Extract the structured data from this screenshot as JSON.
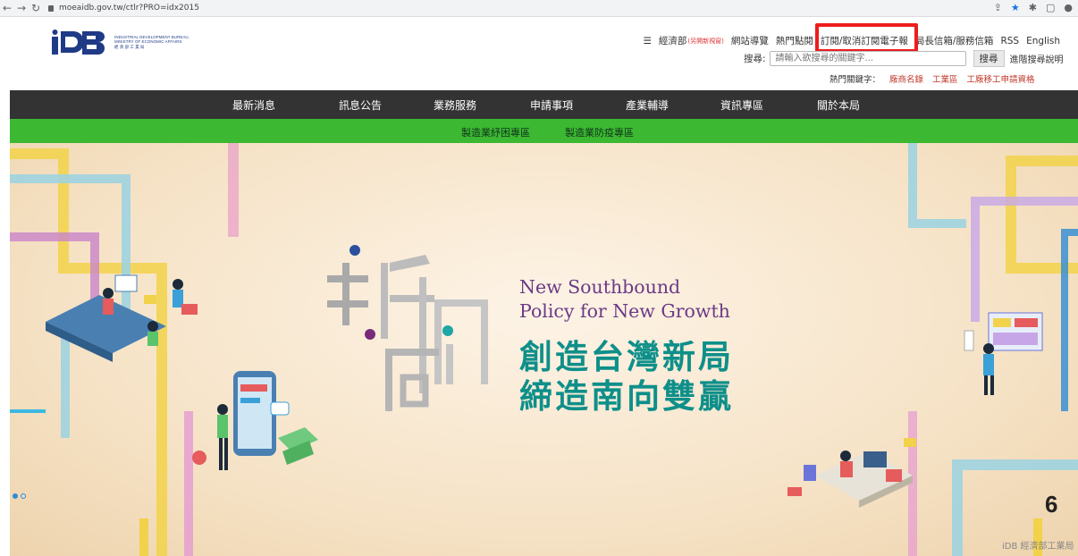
{
  "browser": {
    "url": "moeaidb.gov.tw/ctlr?PRO=idx2015"
  },
  "logo": {
    "mark": "iDB",
    "line1": "INDUSTRIAL DEVELOPMENT BUREAU,",
    "line2": "MINISTRY OF ECONOMIC AFFAIRS",
    "line3": "經 濟 部 工 業 局"
  },
  "top_links": {
    "moea": "經濟部",
    "moea_note": "(另開新視窗)",
    "sitemap": "網站導覽",
    "hot": "熱門點閱",
    "subscribe": "訂閱/取消訂閱電子報",
    "mailbox": "局長信箱/服務信箱",
    "rss": "RSS",
    "english": "English"
  },
  "search": {
    "label": "搜尋:",
    "placeholder": "請輸入欲搜尋的關鍵字...",
    "button": "搜尋",
    "advanced": "進階搜尋說明"
  },
  "hot_keywords": {
    "label": "熱門關鍵字：",
    "items": [
      "廠商名錄",
      "工業區",
      "工廠移工申請資格"
    ]
  },
  "main_nav": [
    "最新消息",
    "訊息公告",
    "業務服務",
    "申請事項",
    "產業輔導",
    "資訊專區",
    "關於本局"
  ],
  "sub_nav": [
    "製造業紓困專區",
    "製造業防疫專區"
  ],
  "banner": {
    "en_line1": "New Southbound",
    "en_line2": "Policy for New Growth",
    "zh_line1": "創造台灣新局",
    "zh_line2": "締造南向雙贏",
    "logo_chars": [
      "新",
      "南",
      "向"
    ],
    "slide_number": "6",
    "corner_logo": "iDB 經濟部工業局"
  },
  "colors": {
    "nav_bg": "#333333",
    "subnav_bg": "#3cb832",
    "highlight": "#ee1c1c",
    "teal": "#0e8f8a",
    "purple": "#6b3a86"
  }
}
